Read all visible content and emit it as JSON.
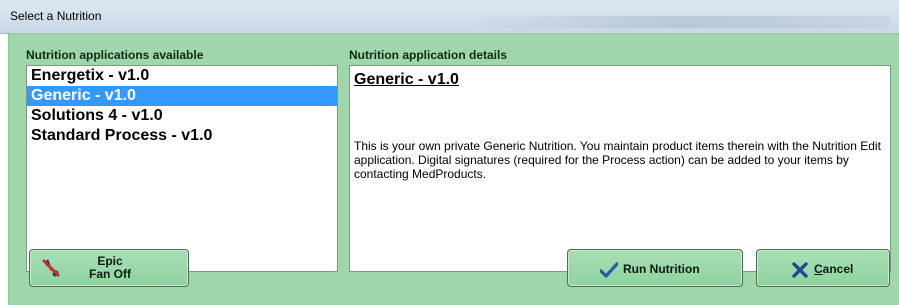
{
  "window": {
    "title": "Select a Nutrition"
  },
  "left": {
    "label": "Nutrition applications available",
    "items": [
      {
        "label": "Energetix - v1.0",
        "selected": false
      },
      {
        "label": "Generic - v1.0",
        "selected": true
      },
      {
        "label": "Solutions 4 - v1.0",
        "selected": false
      },
      {
        "label": "Standard Process - v1.0",
        "selected": false
      }
    ]
  },
  "right": {
    "label": "Nutrition application details",
    "title": "Generic - v1.0",
    "description": "This is your own private Generic Nutrition. You maintain product items therein with the Nutrition Edit application. Digital signatures (required for the Process action) can be added to your items by contacting MedProducts."
  },
  "buttons": {
    "fan": {
      "line1": "Epic",
      "line2": "Fan Off",
      "icon": "fan-off-icon"
    },
    "run": {
      "label": "Run Nutrition",
      "icon": "checkmark-icon"
    },
    "cancel": {
      "mnemonic": "C",
      "label_rest": "ancel",
      "icon": "x-icon"
    }
  },
  "colors": {
    "background": "#9fd7ab",
    "selection": "#3399ff",
    "checkmark": "#1f5fa8",
    "cancel_x": "#1f4c8f",
    "fan_strike": "#d22a2a"
  }
}
